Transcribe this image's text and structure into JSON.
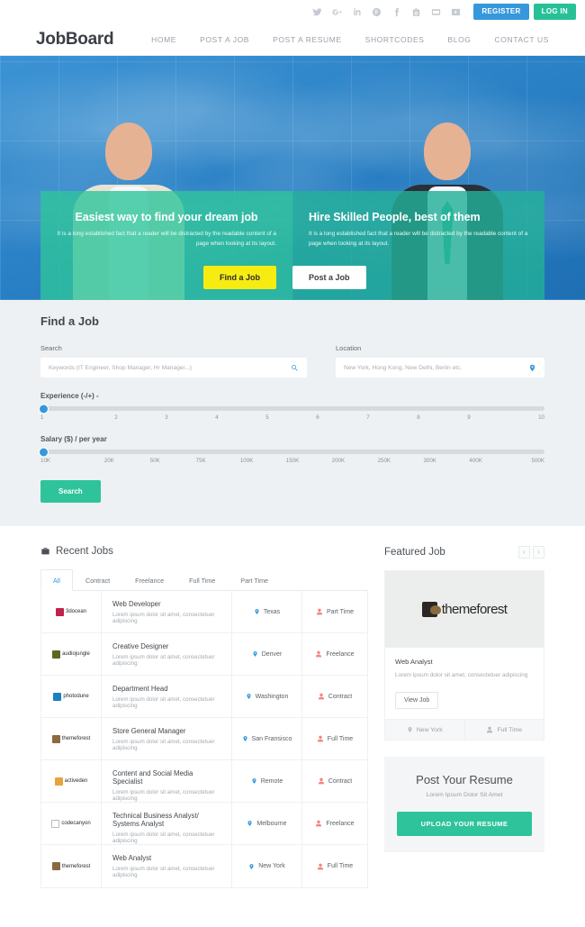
{
  "topbar": {
    "social_icons": [
      "twitter-icon",
      "google-plus-icon",
      "linkedin-icon",
      "pinterest-icon",
      "facebook-icon",
      "youtube-icon",
      "flickr-icon",
      "vimeo-icon"
    ],
    "register_label": "REGISTER",
    "login_label": "LOG IN",
    "register_color": "#3598dc",
    "login_color": "#28c196"
  },
  "header": {
    "logo": "JobBoard",
    "nav": [
      {
        "label": "HOME"
      },
      {
        "label": "POST A JOB"
      },
      {
        "label": "POST A RESUME"
      },
      {
        "label": "SHORTCODES"
      },
      {
        "label": "BLOG"
      },
      {
        "label": "CONTACT US"
      }
    ]
  },
  "hero": {
    "left": {
      "heading": "Easiest way to find your dream job",
      "paragraph": "It is a long established fact that a reader will be distracted by the readable content of a page when looking at its layout.",
      "cta": "Find a Job",
      "cta_color": "#f7ec12"
    },
    "right": {
      "heading": "Hire Skilled People, best of them",
      "paragraph": "It is a long established fact that a reader will be distracted by the readable content of a page when looking at its layout.",
      "cta": "Post a Job",
      "cta_color": "#ffffff"
    }
  },
  "find_job": {
    "title": "Find a Job",
    "search_label": "Search",
    "search_placeholder": "Keywords (IT Engineer, Shop Manager, Hr Manager...)",
    "location_label": "Location",
    "location_placeholder": "New York, Hong Kong, New Delhi, Berlin etc.",
    "experience_label": "Experience (-/+) -",
    "experience_ticks": [
      "1",
      "2",
      "3",
      "4",
      "5",
      "6",
      "7",
      "8",
      "9",
      "10"
    ],
    "experience_value": "1",
    "salary_label": "Salary ($) / per year",
    "salary_ticks": [
      "10K",
      "20K",
      "50K",
      "75K",
      "100K",
      "150K",
      "200K",
      "250K",
      "300K",
      "400K",
      "500K"
    ],
    "salary_value": "10K",
    "search_button": "Search",
    "search_button_color": "#2fc39b",
    "slider_knob_color": "#3598dc"
  },
  "recent_jobs": {
    "title": "Recent Jobs",
    "tabs": [
      {
        "label": "All",
        "active": true
      },
      {
        "label": "Contract",
        "active": false
      },
      {
        "label": "Freelance",
        "active": false
      },
      {
        "label": "Full Time",
        "active": false
      },
      {
        "label": "Part Time",
        "active": false
      }
    ],
    "rows": [
      {
        "company": "3docean",
        "mark": "#c0224a",
        "title": "Web Developer",
        "desc": "Lorem ipsum dolor sit amet, consectetuer adipiscing",
        "location": "Texas",
        "type": "Part Time"
      },
      {
        "company": "audiojungle",
        "mark": "#5a6a1e",
        "title": "Creative Designer",
        "desc": "Lorem ipsum dolor sit amet, consectetuer adipiscing",
        "location": "Denver",
        "type": "Freelance"
      },
      {
        "company": "photodune",
        "mark": "#1b7fc4",
        "title": "Department Head",
        "desc": "Lorem ipsum dolor sit amet, consectetuer adipiscing",
        "location": "Washington",
        "type": "Contract"
      },
      {
        "company": "themeforest",
        "mark": "#8a6a3e",
        "title": "Store General Manager",
        "desc": "Lorem ipsum dolor sit amet, consectetuer adipiscing",
        "location": "San Fransisco",
        "type": "Full Time"
      },
      {
        "company": "activeden",
        "mark": "#e8a33d",
        "title": "Content and Social Media Specialist",
        "desc": "Lorem ipsum dolor sit amet, consectetuer adipiscing",
        "location": "Remote",
        "type": "Contract"
      },
      {
        "company": "codecanyon",
        "mark": "#ffffff",
        "title": "Technical Business Analyst/ Systems Analyst",
        "desc": "Lorem ipsum dolor sit amet, consectetuer adipiscing",
        "location": "Melbourne",
        "type": "Freelance"
      },
      {
        "company": "themeforest",
        "mark": "#8a6a3e",
        "title": "Web Analyst",
        "desc": "Lorem ipsum dolor sit amet, consectetuer adipiscing",
        "location": "New York",
        "type": "Full Time"
      }
    ]
  },
  "featured_job": {
    "title": "Featured Job",
    "prev_icon": "chevron-left-icon",
    "next_icon": "chevron-right-icon",
    "company_logo_text": "themeforest",
    "job_title": "Web Analyst",
    "description": "Lorem ipsum dolor sit amet, consectetuer adipiscing",
    "view_button": "View Job",
    "location": "New York",
    "type": "Full Time"
  },
  "post_resume": {
    "title": "Post Your Resume",
    "subtitle": "Lorem Ipsum Dolor Sit Amet",
    "button": "UPLOAD YOUR RESUME",
    "button_color": "#2fc39b"
  }
}
